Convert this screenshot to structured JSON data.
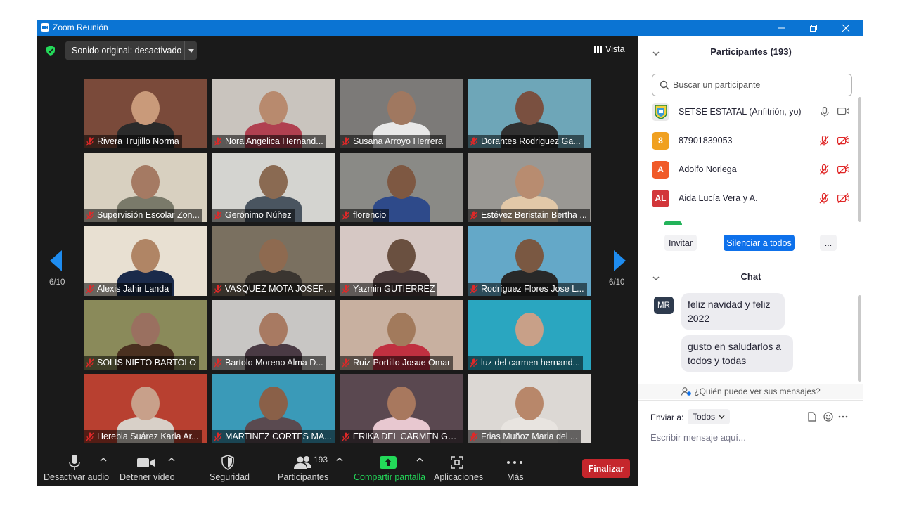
{
  "window": {
    "title": "Zoom Reunión"
  },
  "meeting": {
    "audio_option": "Sonido original: desactivado",
    "view_label": "Vista",
    "page_left": "6/10",
    "page_right": "6/10",
    "tiles": [
      {
        "name": "Rivera Trujillo Norma",
        "bg": "#7a4a3a",
        "person": "#c99a7a",
        "shirt": "#2a2a2a"
      },
      {
        "name": "Nora Angelica Hernand...",
        "bg": "#c9c4be",
        "person": "#b88a6e",
        "shirt": "#b04050"
      },
      {
        "name": "Susana Arroyo Herrera",
        "bg": "#7c7a78",
        "person": "#a07860",
        "shirt": "#e8e8e8"
      },
      {
        "name": "Dorantes Rodriguez Ga...",
        "bg": "#6ea6b8",
        "person": "#7a5040",
        "shirt": "#303030"
      },
      {
        "name": "Supervisión Escolar Zon...",
        "bg": "#d8d0c0",
        "person": "#a57a63",
        "shirt": "#7a7a6a"
      },
      {
        "name": "Gerónimo Núñez",
        "bg": "#d4d4d0",
        "person": "#8a6a52",
        "shirt": "#4a5560"
      },
      {
        "name": "florencio",
        "bg": "#8a8a86",
        "person": "#7e5842",
        "shirt": "#2e4a8a"
      },
      {
        "name": "Estévez Beristain Bertha ...",
        "bg": "#9a9894",
        "person": "#b88c70",
        "shirt": "#e2c8a8"
      },
      {
        "name": "Alexis Jahir Landa",
        "bg": "#e8e0d2",
        "person": "#b08565",
        "shirt": "#1a2a4a"
      },
      {
        "name": "VASQUEZ MOTA JOSEFI...",
        "bg": "#7a7060",
        "person": "#8e6a50",
        "shirt": "#3a3530"
      },
      {
        "name": "Yazmin GUTIERREZ",
        "bg": "#d6c8c4",
        "person": "#6a5040",
        "shirt": "#4a3a3a"
      },
      {
        "name": "Rodríguez Flores Jose L...",
        "bg": "#64a8c8",
        "person": "#7a5842",
        "shirt": "#282828"
      },
      {
        "name": "SOLIS NIETO BARTOLO",
        "bg": "#8a8a5a",
        "person": "#9a7060",
        "shirt": "#4a3020"
      },
      {
        "name": "Bartolo Moreno Alma D...",
        "bg": "#c8c6c4",
        "person": "#a87a62",
        "shirt": "#4a3a44"
      },
      {
        "name": "Ruiz Portillo Josue Omar",
        "bg": "#c8b0a0",
        "person": "#a27a5c",
        "shirt": "#c03040"
      },
      {
        "name": "luz del carmen hernand...",
        "bg": "#2aa6c0",
        "person": "#c8a088",
        "shirt": "#2aa6c0"
      },
      {
        "name": "Herebia Suárez Karla Ar...",
        "bg": "#b84030",
        "person": "#c8a08a",
        "shirt": "#d8d0c8"
      },
      {
        "name": "MARTINEZ CORTES MA...",
        "bg": "#3a9ab8",
        "person": "#8a6048",
        "shirt": "#5a4a50"
      },
      {
        "name": "ERIKA DEL CARMEN GO...",
        "bg": "#5a4850",
        "person": "#a8785e",
        "shirt": "#e8c8d0"
      },
      {
        "name": "Frias Muñoz Maria del ...",
        "bg": "#dcd8d4",
        "person": "#b8876a",
        "shirt": "#e8e4e0"
      }
    ]
  },
  "toolbar": {
    "mute": "Desactivar audio",
    "video": "Detener vídeo",
    "security": "Seguridad",
    "participants": "Participantes",
    "participants_count": "193",
    "share": "Compartir pantalla",
    "apps": "Aplicaciones",
    "more": "Más",
    "end": "Finalizar"
  },
  "participants_panel": {
    "title": "Participantes (193)",
    "search_placeholder": "Buscar un participante",
    "rows": [
      {
        "initials": "",
        "name": "SETSE ESTATAL (Anfitrión, yo)",
        "color": "#e9e9e9"
      },
      {
        "initials": "8",
        "name": "87901839053",
        "color": "#f0a020"
      },
      {
        "initials": "A",
        "name": "Adolfo Noriega",
        "color": "#f05a28"
      },
      {
        "initials": "AL",
        "name": "Aida Lucía Vera y A.",
        "color": "#d2363a"
      }
    ],
    "invite": "Invitar",
    "mute_all": "Silenciar a todos",
    "more": "..."
  },
  "chat": {
    "title": "Chat",
    "sender_initials": "MR",
    "messages": [
      "feliz navidad y feliz 2022",
      "gusto en saludarlos a todos y todas"
    ],
    "visibility": "¿Quién puede ver sus mensajes?",
    "send_to_label": "Enviar a:",
    "send_to_value": "Todos",
    "input_placeholder": "Escribir mensaje aquí..."
  },
  "colors": {
    "titlebar": "#0b74d3",
    "accent": "#0e71eb",
    "end": "#c5262c",
    "share": "#23d959",
    "muted": "#e02828"
  }
}
